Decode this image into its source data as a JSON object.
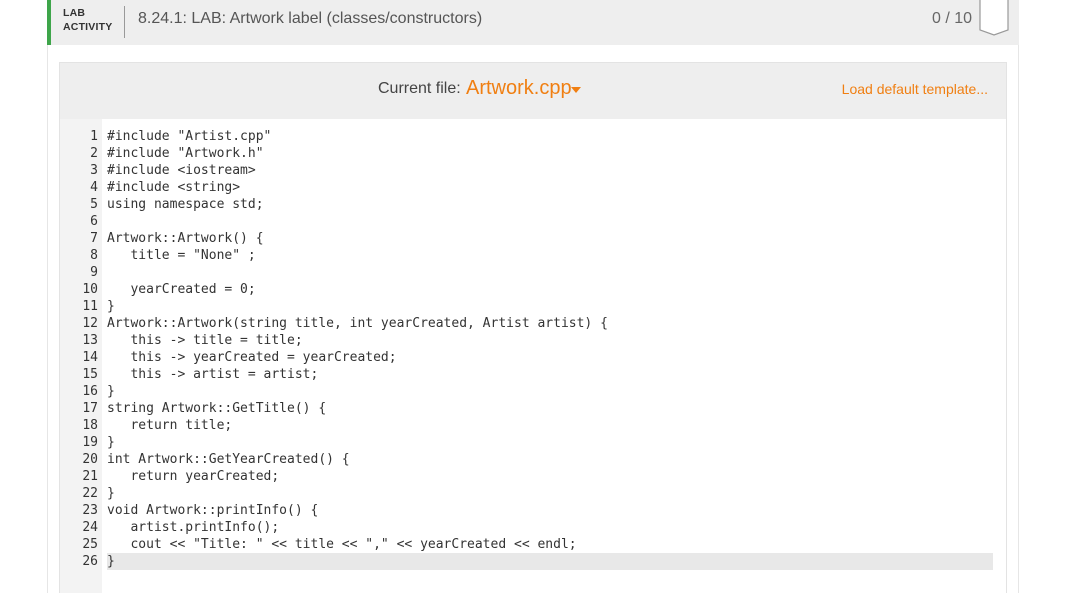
{
  "header": {
    "lab_line1": "LAB",
    "lab_line2": "ACTIVITY",
    "title": "8.24.1: LAB: Artwork label (classes/constructors)",
    "score": "0 / 10",
    "accent_color": "#3ea54a"
  },
  "editor": {
    "current_file_label": "Current file:",
    "current_file": "Artwork.cpp",
    "load_default": "Load default template...",
    "accent_color": "#f07f12"
  },
  "code": {
    "lines": [
      {
        "n": "1",
        "text": "#include \"Artist.cpp\""
      },
      {
        "n": "2",
        "text": "#include \"Artwork.h\""
      },
      {
        "n": "3",
        "text": "#include <iostream>"
      },
      {
        "n": "4",
        "text": "#include <string>"
      },
      {
        "n": "5",
        "text": "using namespace std;"
      },
      {
        "n": "6",
        "text": ""
      },
      {
        "n": "7",
        "text": "Artwork::Artwork() {"
      },
      {
        "n": "8",
        "text": "   title = \"None\" ;"
      },
      {
        "n": "9",
        "text": ""
      },
      {
        "n": "10",
        "text": "   yearCreated = 0;"
      },
      {
        "n": "11",
        "text": "}"
      },
      {
        "n": "12",
        "text": "Artwork::Artwork(string title, int yearCreated, Artist artist) {"
      },
      {
        "n": "13",
        "text": "   this -> title = title;"
      },
      {
        "n": "14",
        "text": "   this -> yearCreated = yearCreated;"
      },
      {
        "n": "15",
        "text": "   this -> artist = artist;"
      },
      {
        "n": "16",
        "text": "}"
      },
      {
        "n": "17",
        "text": "string Artwork::GetTitle() {"
      },
      {
        "n": "18",
        "text": "   return title;"
      },
      {
        "n": "19",
        "text": "}"
      },
      {
        "n": "20",
        "text": "int Artwork::GetYearCreated() {"
      },
      {
        "n": "21",
        "text": "   return yearCreated;"
      },
      {
        "n": "22",
        "text": "}"
      },
      {
        "n": "23",
        "text": "void Artwork::printInfo() {"
      },
      {
        "n": "24",
        "text": "   artist.printInfo();"
      },
      {
        "n": "25",
        "text": "   cout << \"Title: \" << title << \",\" << yearCreated << endl;"
      },
      {
        "n": "26",
        "text": "}"
      }
    ],
    "active_line": "26"
  }
}
